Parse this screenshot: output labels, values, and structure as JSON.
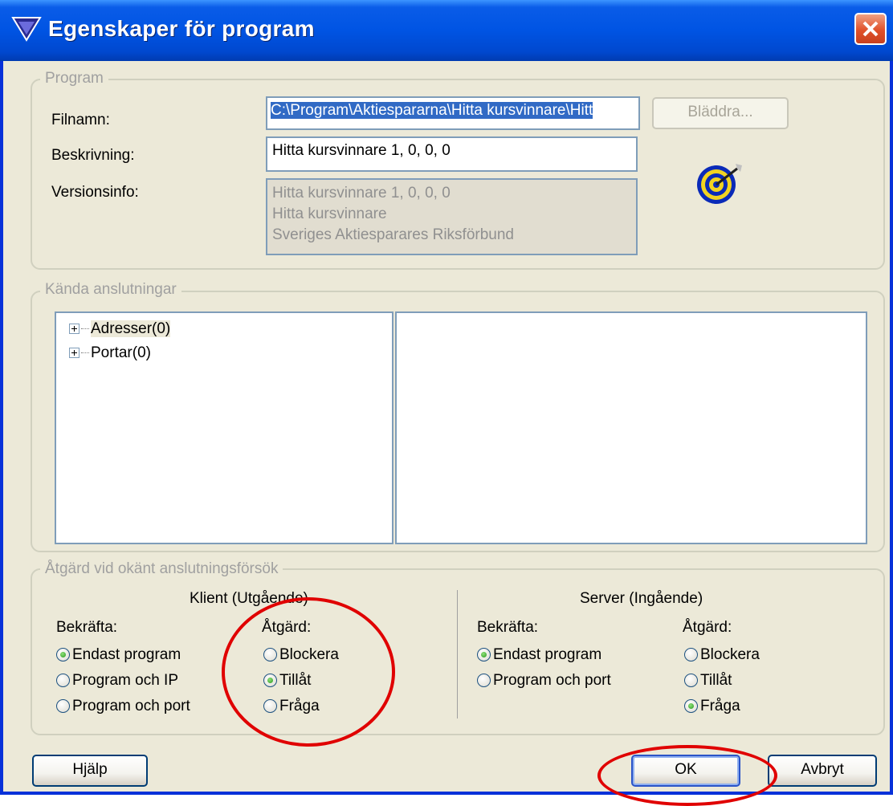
{
  "window": {
    "title": "Egenskaper för program",
    "icon": "funnel-triangle-icon",
    "close_icon": "close-icon"
  },
  "program_group": {
    "label": "Program",
    "filename_label": "Filnamn:",
    "filename_value": "C:\\Program\\Aktiespararna\\Hitta kursvinnare\\Hitt",
    "browse_label": "Bläddra...",
    "description_label": "Beskrivning:",
    "description_value": "Hitta kursvinnare 1, 0, 0, 0",
    "version_label": "Versionsinfo:",
    "version_lines": [
      "Hitta kursvinnare 1, 0, 0, 0",
      "Hitta kursvinnare",
      "Sveriges Aktiesparares Riksförbund"
    ],
    "app_icon": "target-dart-icon"
  },
  "connections_group": {
    "label": "Kända anslutningar",
    "tree": [
      "Adresser(0)",
      "Portar(0)"
    ]
  },
  "action_group": {
    "label": "Åtgärd vid okänt anslutningsförsök",
    "client": {
      "header": "Klient (Utgående)",
      "confirm_label": "Bekräfta:",
      "confirm_options": [
        "Endast program",
        "Program och IP",
        "Program och port"
      ],
      "confirm_selected": 0,
      "action_label": "Åtgärd:",
      "action_options": [
        "Blockera",
        "Tillåt",
        "Fråga"
      ],
      "action_selected": 1
    },
    "server": {
      "header": "Server (Ingående)",
      "confirm_label": "Bekräfta:",
      "confirm_options": [
        "Endast program",
        "Program och port"
      ],
      "confirm_selected": 0,
      "action_label": "Åtgärd:",
      "action_options": [
        "Blockera",
        "Tillåt",
        "Fråga"
      ],
      "action_selected": 2
    }
  },
  "buttons": {
    "help": "Hjälp",
    "ok": "OK",
    "cancel": "Avbryt"
  },
  "colors": {
    "title_bar": "#0054e3",
    "annotation": "#e00000",
    "selected_text_bg": "#316ac5"
  }
}
